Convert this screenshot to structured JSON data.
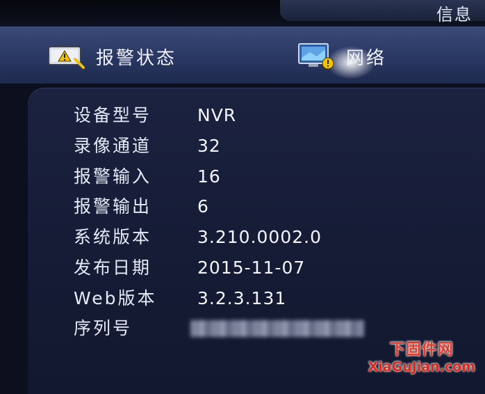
{
  "window": {
    "title": "信息"
  },
  "tabs": [
    {
      "label": "报警状态",
      "icon": "alarm-status-icon"
    },
    {
      "label": "网络",
      "icon": "network-icon"
    }
  ],
  "info_rows": [
    {
      "label": "设备型号",
      "value": "NVR"
    },
    {
      "label": "录像通道",
      "value": "32"
    },
    {
      "label": "报警输入",
      "value": "16"
    },
    {
      "label": "报警输出",
      "value": "6"
    },
    {
      "label": "系统版本",
      "value": "3.210.0002.0"
    },
    {
      "label": "发布日期",
      "value": "2015-11-07"
    },
    {
      "label": "Web版本",
      "value": "3.2.3.131"
    },
    {
      "label": "序列号",
      "value": ""
    }
  ],
  "watermark": {
    "text_cn": "下固件网",
    "text_en": "XiaGuJian.com"
  },
  "colors": {
    "accent": "#3b4a78",
    "panel": "#1b2240",
    "text": "#e6ebf6",
    "watermark": "#e23a2a"
  }
}
